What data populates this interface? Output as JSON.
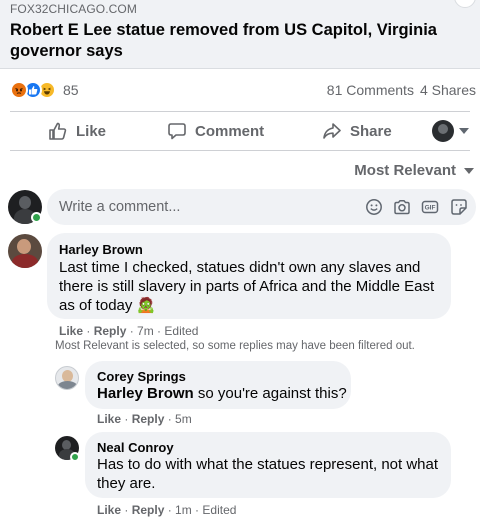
{
  "link_card": {
    "domain": "FOX32CHICAGO.COM",
    "headline": "Robert E Lee statue removed from US Capitol, Virginia governor says"
  },
  "stats": {
    "reaction_icons": [
      "angry-reaction-icon",
      "like-reaction-icon",
      "haha-reaction-icon"
    ],
    "reaction_count": "85",
    "comments": "81 Comments",
    "shares": "4 Shares"
  },
  "actions": {
    "like": "Like",
    "comment": "Comment",
    "share": "Share"
  },
  "sort": {
    "label": "Most Relevant"
  },
  "composer": {
    "placeholder": "Write a comment...",
    "icons": [
      "emoji-icon",
      "camera-icon",
      "gif-icon",
      "sticker-icon"
    ]
  },
  "comments": [
    {
      "author": "Harley Brown",
      "text": "Last time I checked, statues didn't own any slaves and there is still slavery in parts of Africa and the Middle East as of today",
      "emoji": "🧟",
      "like": "Like",
      "reply": "Reply",
      "time": "7m",
      "edited": "Edited"
    }
  ],
  "filter_notice": "Most Relevant is selected, so some replies may have been filtered out.",
  "replies": [
    {
      "author": "Corey Springs",
      "tag": "Harley Brown",
      "text": " so you're against this?",
      "like": "Like",
      "reply": "Reply",
      "time": "5m"
    },
    {
      "author": "Neal Conroy",
      "text": "Has to do with what the statues represent, not what they are.",
      "like": "Like",
      "reply": "Reply",
      "time": "1m",
      "edited": "Edited"
    }
  ],
  "colors": {
    "accent": "#1877f2",
    "secondary_text": "#65676b",
    "bubble": "#f0f2f5",
    "online": "#31a24c"
  }
}
